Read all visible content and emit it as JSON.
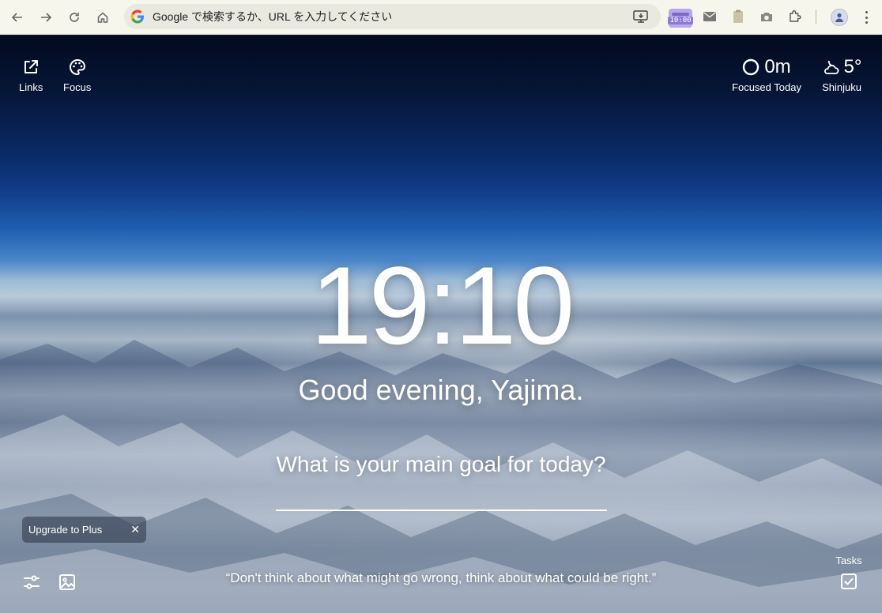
{
  "browser": {
    "omnibox_text": "Google で検索するか、URL を入力してください",
    "extension_clock_text": "10:00"
  },
  "top_left": {
    "links_label": "Links",
    "focus_label": "Focus"
  },
  "focus_stats": {
    "value": "0m",
    "label": "Focused Today"
  },
  "weather": {
    "temperature": "5°",
    "location": "Shinjuku"
  },
  "clock": {
    "time": "19:10"
  },
  "greeting": {
    "text": "Good evening, Yajima."
  },
  "goal": {
    "question": "What is your main goal for today?",
    "value": ""
  },
  "upgrade": {
    "label": "Upgrade to Plus",
    "close": "✕"
  },
  "quote": {
    "text": "“Don't think about what might go wrong, think about what could be right.”"
  },
  "tasks": {
    "label": "Tasks"
  }
}
